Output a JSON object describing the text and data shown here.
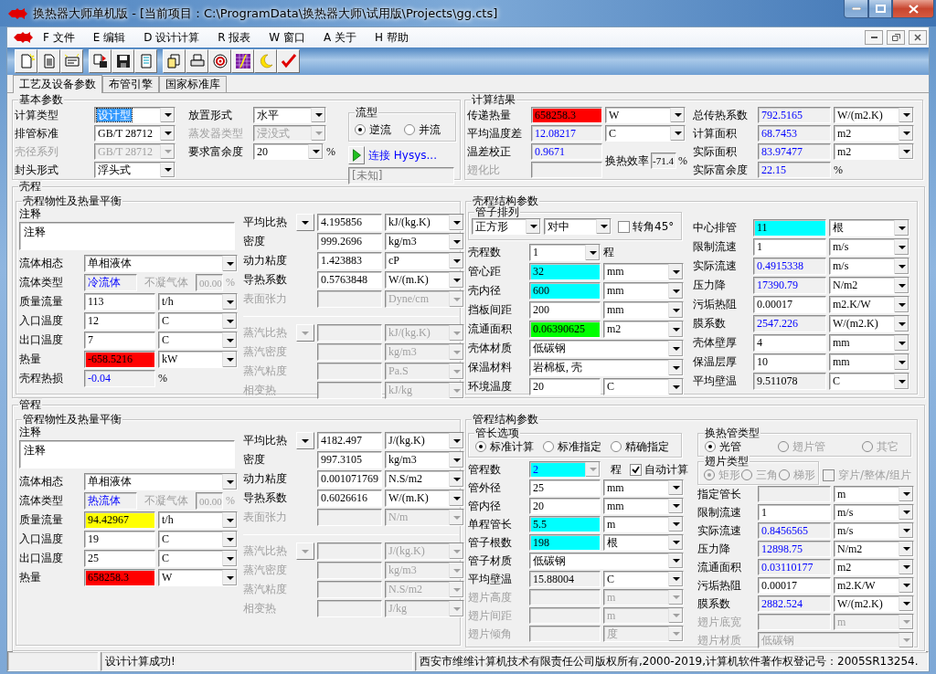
{
  "window": {
    "title": "换热器大师单机版 - [当前项目：C:\\ProgramData\\换热器大师\\试用版\\Projects\\gg.cts]"
  },
  "menu": [
    "F 文件",
    "E 编辑",
    "D 设计计算",
    "R 报表",
    "W 窗口",
    "A 关于",
    "H 帮助"
  ],
  "tabs": [
    {
      "label": "工艺及设备参数",
      "selected": true
    },
    {
      "label": "布管引擎",
      "selected": false
    },
    {
      "label": "国家标准库",
      "selected": false
    }
  ],
  "basic": {
    "title": "基本参数",
    "rows": [
      {
        "kind": "select",
        "label": "计算类型",
        "value": "设计型",
        "disabled": false,
        "focused": true
      },
      {
        "kind": "select",
        "label": "排管标准",
        "value": "GB/T 28712",
        "disabled": false,
        "focused": false
      },
      {
        "kind": "select",
        "label": "壳径系列",
        "value": "GB/T 28712",
        "disabled": true,
        "focused": false
      },
      {
        "kind": "select",
        "label": "封头形式",
        "value": "浮头式",
        "disabled": false,
        "focused": false
      }
    ],
    "rows2": [
      {
        "kind": "select",
        "label": "放置形式",
        "value": "水平",
        "disabled": false
      },
      {
        "kind": "select",
        "label": "蒸发器类型",
        "value": "浸没式",
        "disabled": true
      },
      {
        "kind": "select_suffix",
        "label": "要求富余度",
        "value": "20",
        "suffix": "%",
        "disabled": false
      }
    ],
    "flow": {
      "title": "流型",
      "options": [
        {
          "label": "逆流",
          "selected": true
        },
        {
          "label": "并流",
          "selected": false
        }
      ]
    },
    "hysys": {
      "label": "连接 Hysys...",
      "status": "[未知]"
    }
  },
  "results": {
    "title": "计算结果",
    "rows": [
      {
        "kind": "measure",
        "label": "传递热量",
        "disabled": false,
        "field": {
          "kind": "input",
          "value": "658258.3",
          "color": "#ff0000"
        },
        "unit": "W"
      },
      {
        "kind": "measure",
        "label": "平均温度差",
        "disabled": false,
        "field": {
          "kind": "output",
          "value": "12.08217"
        },
        "unit": "C"
      },
      {
        "kind": "blank",
        "label": "温差校正",
        "disabled": false,
        "field": {
          "kind": "output",
          "value": "0.9671"
        }
      },
      {
        "kind": "blank",
        "label": "翅化比",
        "disabled": true
      }
    ],
    "efficiency": {
      "label": "换热效率",
      "field": {
        "kind": "fixed",
        "value": "-71.4"
      },
      "suffix": "%"
    },
    "rows2": [
      {
        "kind": "measure",
        "label": "总传热系数",
        "disabled": false,
        "field": {
          "kind": "output",
          "value": "792.5165"
        },
        "unit": "W/(m2.K)"
      },
      {
        "kind": "measure",
        "label": "计算面积",
        "disabled": false,
        "field": {
          "kind": "output",
          "value": "68.7453"
        },
        "unit": "m2"
      },
      {
        "kind": "measure",
        "label": "实际面积",
        "disabled": false,
        "field": {
          "kind": "output",
          "value": "83.97477"
        },
        "unit": "m2"
      },
      {
        "kind": "value_suffix",
        "label": "实际富余度",
        "disabled": false,
        "field": {
          "kind": "output",
          "value": "22.15"
        },
        "suffix": "%"
      }
    ]
  },
  "shell": {
    "title": "壳程",
    "balance": {
      "title": "壳程物性及热量平衡",
      "note_label": "注释",
      "note": "注释",
      "rows": [
        {
          "kind": "select",
          "label": "流体相态",
          "value": "单相液体",
          "disabled": false
        },
        {
          "kind": "fluid_type",
          "label": "流体类型",
          "disabled": false,
          "field": {
            "kind": "output",
            "value": "冷流体"
          },
          "gas_label": "不凝气体",
          "gas_value": "00.00",
          "gas_disabled": true,
          "suffix": "%"
        },
        {
          "kind": "measure",
          "label": "质量流量",
          "disabled": false,
          "field": {
            "kind": "input",
            "value": "113"
          },
          "unit": "t/h"
        },
        {
          "kind": "measure",
          "label": "入口温度",
          "disabled": false,
          "field": {
            "kind": "input",
            "value": "12"
          },
          "unit": "C"
        },
        {
          "kind": "measure",
          "label": "出口温度",
          "disabled": false,
          "field": {
            "kind": "input",
            "value": "7"
          },
          "unit": "C"
        },
        {
          "kind": "measure",
          "label": "热量",
          "disabled": false,
          "field": {
            "kind": "input",
            "value": "-658.5216",
            "color": "#ff0000"
          },
          "unit": "kW"
        },
        {
          "kind": "value_suffix",
          "label": "壳程热损",
          "disabled": false,
          "field": {
            "kind": "output",
            "value": "-0.04"
          },
          "suffix": "%"
        }
      ],
      "props": [
        {
          "kind": "measure",
          "label": "平均比热",
          "picker": true,
          "disabled": false,
          "field": {
            "kind": "input",
            "value": "4.195856"
          },
          "unit": "kJ/(kg.K)"
        },
        {
          "kind": "measure",
          "label": "密度",
          "picker": false,
          "disabled": false,
          "field": {
            "kind": "input",
            "value": "999.2696"
          },
          "unit": "kg/m3"
        },
        {
          "kind": "measure",
          "label": "动力粘度",
          "picker": false,
          "disabled": false,
          "field": {
            "kind": "input",
            "value": "1.423883"
          },
          "unit": "cP"
        },
        {
          "kind": "measure",
          "label": "导热系数",
          "picker": false,
          "disabled": false,
          "field": {
            "kind": "input",
            "value": "0.5763848"
          },
          "unit": "W/(m.K)"
        },
        {
          "kind": "measure",
          "label": "表面张力",
          "picker": false,
          "disabled": true,
          "unit": "Dyne/cm"
        }
      ],
      "vapor": [
        {
          "kind": "measure",
          "label": "蒸汽比热",
          "picker": true,
          "disabled": true,
          "unit": "kJ/(kg.K)"
        },
        {
          "kind": "measure",
          "label": "蒸汽密度",
          "picker": false,
          "disabled": true,
          "unit": "kg/m3"
        },
        {
          "kind": "measure",
          "label": "蒸汽粘度",
          "picker": false,
          "disabled": true,
          "unit": "Pa.S"
        },
        {
          "kind": "measure",
          "label": "相变热",
          "picker": false,
          "disabled": true,
          "unit": "kJ/kg"
        }
      ]
    },
    "structure": {
      "title": "壳程结构参数",
      "layout": {
        "title": "管子排列",
        "pattern": "正方形",
        "align": "对中",
        "rotate_label": "转角45°",
        "rotate_checked": false
      },
      "rows": [
        {
          "kind": "select_suffix",
          "label": "壳程数",
          "value": "1",
          "suffix": "程",
          "disabled": false
        },
        {
          "kind": "measure",
          "label": "管心距",
          "disabled": false,
          "field": {
            "kind": "input",
            "value": "32",
            "color": "#00ffff"
          },
          "unit": "mm"
        },
        {
          "kind": "measure",
          "label": "壳内径",
          "disabled": false,
          "field": {
            "kind": "input",
            "value": "600",
            "color": "#00ffff"
          },
          "unit": "mm"
        },
        {
          "kind": "measure",
          "label": "挡板间距",
          "disabled": false,
          "field": {
            "kind": "input",
            "value": "200"
          },
          "unit": "mm"
        },
        {
          "kind": "measure",
          "label": "流通面积",
          "disabled": false,
          "field": {
            "kind": "input",
            "value": "0.06390625",
            "color": "#00ff00"
          },
          "unit": "m2"
        },
        {
          "kind": "select",
          "label": "壳体材质",
          "value": "低碳钢",
          "disabled": false
        },
        {
          "kind": "select",
          "label": "保温材料",
          "value": "岩棉板, 壳",
          "disabled": false
        },
        {
          "kind": "measure",
          "label": "环境温度",
          "disabled": false,
          "field": {
            "kind": "input",
            "value": "20"
          },
          "unit": "C"
        }
      ],
      "rows2": [
        {
          "kind": "measure",
          "label": "中心排管",
          "disabled": false,
          "field": {
            "kind": "input",
            "value": "11",
            "color": "#00ffff"
          },
          "unit": "根"
        },
        {
          "kind": "measure",
          "label": "限制流速",
          "disabled": false,
          "field": {
            "kind": "input",
            "value": "1"
          },
          "unit": "m/s"
        },
        {
          "kind": "measure",
          "label": "实际流速",
          "disabled": false,
          "field": {
            "kind": "output",
            "value": "0.4915338"
          },
          "unit": "m/s"
        },
        {
          "kind": "measure",
          "label": "压力降",
          "disabled": false,
          "field": {
            "kind": "output",
            "value": "17390.79"
          },
          "unit": "N/m2"
        },
        {
          "kind": "measure",
          "label": "污垢热阻",
          "disabled": false,
          "field": {
            "kind": "input",
            "value": "0.00017"
          },
          "unit": "m2.K/W"
        },
        {
          "kind": "measure",
          "label": "膜系数",
          "disabled": false,
          "field": {
            "kind": "output",
            "value": "2547.226"
          },
          "unit": "W/(m2.K)"
        },
        {
          "kind": "measure",
          "label": "壳体壁厚",
          "disabled": false,
          "field": {
            "kind": "input",
            "value": "4"
          },
          "unit": "mm"
        },
        {
          "kind": "measure",
          "label": "保温层厚",
          "disabled": false,
          "field": {
            "kind": "input",
            "value": "10"
          },
          "unit": "mm"
        },
        {
          "kind": "measure",
          "label": "平均壁温",
          "disabled": false,
          "field": {
            "kind": "fixed",
            "value": "9.511078"
          },
          "unit": "C"
        }
      ]
    }
  },
  "tube": {
    "title": "管程",
    "balance": {
      "title": "管程物性及热量平衡",
      "note_label": "注释",
      "note": "注释",
      "rows": [
        {
          "kind": "select",
          "label": "流体相态",
          "value": "单相液体",
          "disabled": false
        },
        {
          "kind": "fluid_type",
          "label": "流体类型",
          "disabled": false,
          "field": {
            "kind": "output",
            "value": "热流体"
          },
          "gas_label": "不凝气体",
          "gas_value": "00.00",
          "gas_disabled": true,
          "suffix": "%"
        },
        {
          "kind": "measure",
          "label": "质量流量",
          "disabled": false,
          "field": {
            "kind": "input",
            "value": "94.42967",
            "color": "#ffff00"
          },
          "unit": "t/h"
        },
        {
          "kind": "measure",
          "label": "入口温度",
          "disabled": false,
          "field": {
            "kind": "input",
            "value": "19"
          },
          "unit": "C"
        },
        {
          "kind": "measure",
          "label": "出口温度",
          "disabled": false,
          "field": {
            "kind": "input",
            "value": "25"
          },
          "unit": "C"
        },
        {
          "kind": "measure",
          "label": "热量",
          "disabled": false,
          "field": {
            "kind": "input",
            "value": "658258.3",
            "color": "#ff0000"
          },
          "unit": "W"
        }
      ],
      "props": [
        {
          "kind": "measure",
          "label": "平均比热",
          "picker": true,
          "disabled": false,
          "field": {
            "kind": "input",
            "value": "4182.497"
          },
          "unit": "J/(kg.K)"
        },
        {
          "kind": "measure",
          "label": "密度",
          "picker": false,
          "disabled": false,
          "field": {
            "kind": "input",
            "value": "997.3105"
          },
          "unit": "kg/m3"
        },
        {
          "kind": "measure",
          "label": "动力粘度",
          "picker": false,
          "disabled": false,
          "field": {
            "kind": "input",
            "value": "0.001071769"
          },
          "unit": "N.S/m2"
        },
        {
          "kind": "measure",
          "label": "导热系数",
          "picker": false,
          "disabled": false,
          "field": {
            "kind": "input",
            "value": "0.6026616"
          },
          "unit": "W/(m.K)"
        },
        {
          "kind": "measure",
          "label": "表面张力",
          "picker": false,
          "disabled": true,
          "unit": "N/m"
        }
      ],
      "vapor": [
        {
          "kind": "measure",
          "label": "蒸汽比热",
          "picker": true,
          "disabled": true,
          "unit": "J/(kg.K)"
        },
        {
          "kind": "measure",
          "label": "蒸汽密度",
          "picker": false,
          "disabled": true,
          "unit": "kg/m3"
        },
        {
          "kind": "measure",
          "label": "蒸汽粘度",
          "picker": false,
          "disabled": true,
          "unit": "N.S/m2"
        },
        {
          "kind": "measure",
          "label": "相变热",
          "picker": false,
          "disabled": true,
          "unit": "J/kg"
        }
      ]
    },
    "structure": {
      "title": "管程结构参数",
      "length_option": {
        "title": "管长选项",
        "options": [
          {
            "label": "标准计算",
            "selected": true
          },
          {
            "label": "标准指定",
            "selected": false
          },
          {
            "label": "精确指定",
            "selected": false
          }
        ]
      },
      "rows": [
        {
          "kind": "select_check",
          "label": "管程数",
          "disabled": false,
          "field": {
            "kind": "output",
            "value": "2",
            "color": "#00ffff"
          },
          "suffix": "程",
          "check_label": "自动计算",
          "checked": true
        },
        {
          "kind": "measure",
          "label": "管外径",
          "disabled": false,
          "field": {
            "kind": "input",
            "value": "25"
          },
          "unit": "mm"
        },
        {
          "kind": "measure",
          "label": "管内径",
          "disabled": false,
          "field": {
            "kind": "input",
            "value": "20"
          },
          "unit": "mm"
        },
        {
          "kind": "measure",
          "label": "单程管长",
          "disabled": false,
          "field": {
            "kind": "input",
            "value": "5.5",
            "color": "#00ffff"
          },
          "unit": "m"
        },
        {
          "kind": "measure",
          "label": "管子根数",
          "disabled": false,
          "field": {
            "kind": "input",
            "value": "198",
            "color": "#00ffff"
          },
          "unit": "根"
        },
        {
          "kind": "select",
          "label": "管子材质",
          "value": "低碳钢",
          "disabled": false
        },
        {
          "kind": "measure",
          "label": "平均壁温",
          "disabled": false,
          "field": {
            "kind": "fixed",
            "value": "15.88004"
          },
          "unit": "C"
        },
        {
          "kind": "measure",
          "label": "翅片高度",
          "disabled": true,
          "unit": "m"
        },
        {
          "kind": "measure",
          "label": "翅片间距",
          "disabled": true,
          "unit": "m"
        },
        {
          "kind": "measure",
          "label": "翅片倾角",
          "disabled": true,
          "unit": "度"
        }
      ],
      "tube_type": {
        "title": "换热管类型",
        "options": [
          {
            "label": "光管",
            "selected": true,
            "disabled": false
          },
          {
            "label": "翅片管",
            "selected": false,
            "disabled": true
          },
          {
            "label": "其它",
            "selected": false,
            "disabled": true
          }
        ]
      },
      "fin_type": {
        "title": "翅片类型",
        "options": [
          {
            "label": "矩形",
            "selected": true,
            "disabled": true
          },
          {
            "label": "三角",
            "selected": false,
            "disabled": true
          },
          {
            "label": "梯形",
            "selected": false,
            "disabled": true
          }
        ],
        "check": {
          "label": "穿片/整体/组片",
          "checked": false,
          "disabled": true
        }
      },
      "rows2": [
        {
          "kind": "measure",
          "label": "指定管长",
          "disabled": false,
          "field": {
            "kind": "fixed"
          },
          "unit": "m"
        },
        {
          "kind": "measure",
          "label": "限制流速",
          "disabled": false,
          "field": {
            "kind": "input",
            "value": "1"
          },
          "unit": "m/s"
        },
        {
          "kind": "measure",
          "label": "实际流速",
          "disabled": false,
          "field": {
            "kind": "output",
            "value": "0.8456565"
          },
          "unit": "m/s"
        },
        {
          "kind": "measure",
          "label": "压力降",
          "disabled": false,
          "field": {
            "kind": "output",
            "value": "12898.75"
          },
          "unit": "N/m2"
        },
        {
          "kind": "measure",
          "label": "流通面积",
          "disabled": false,
          "field": {
            "kind": "output",
            "value": "0.03110177"
          },
          "unit": "m2"
        },
        {
          "kind": "measure",
          "label": "污垢热阻",
          "disabled": false,
          "field": {
            "kind": "input",
            "value": "0.00017"
          },
          "unit": "m2.K/W"
        },
        {
          "kind": "measure",
          "label": "膜系数",
          "disabled": false,
          "field": {
            "kind": "output",
            "value": "2882.524"
          },
          "unit": "W/(m2.K)"
        },
        {
          "kind": "measure",
          "label": "翅片底宽",
          "disabled": true,
          "unit": "m"
        },
        {
          "kind": "select",
          "label": "翅片材质",
          "value": "低碳钢",
          "disabled": true
        }
      ]
    }
  },
  "status_bar": {
    "message": "设计计算成功!",
    "copyright": "西安市维维计算机技术有限责任公司版权所有,2000-2019,计算机软件著作权登记号：2005SR13254."
  }
}
